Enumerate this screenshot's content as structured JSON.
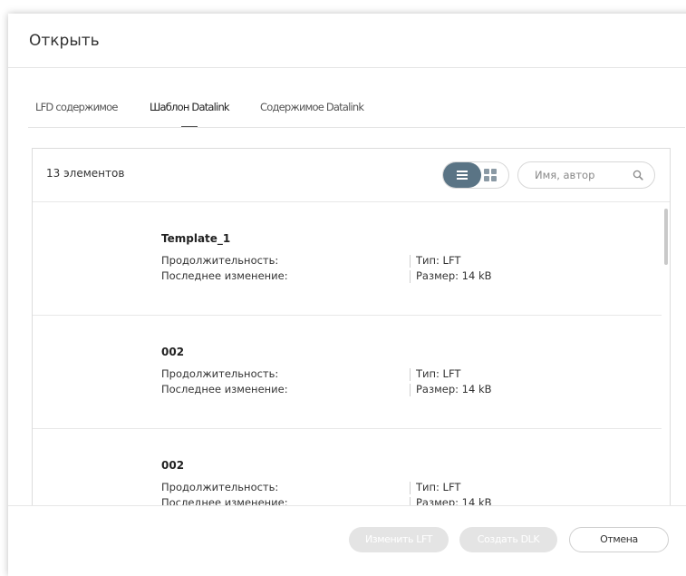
{
  "dialog": {
    "title": "Открыть"
  },
  "tabs": [
    {
      "label": "LFD содержимое",
      "active": false
    },
    {
      "label": "Шаблон Datalink",
      "active": true
    },
    {
      "label": "Содержимое Datalink",
      "active": false
    }
  ],
  "panel": {
    "count": "13 элементов",
    "view": "list",
    "search": {
      "placeholder": "Имя, автор",
      "value": ""
    }
  },
  "items": [
    {
      "name": "Template_1",
      "duration_label": "Продолжительность:",
      "modified_label": "Последнее изменение:",
      "type": "Тип: LFT",
      "size": "Размер: 14 kB"
    },
    {
      "name": "002",
      "duration_label": "Продолжительность:",
      "modified_label": "Последнее изменение:",
      "type": "Тип: LFT",
      "size": "Размер: 14 kB"
    },
    {
      "name": "002",
      "duration_label": "Продолжительность:",
      "modified_label": "Последнее изменение:",
      "type": "Тип: LFT",
      "size": "Размер: 14 kB"
    }
  ],
  "buttons": {
    "edit_lft": "Изменить LFT",
    "create_dlk": "Создать DLK",
    "cancel": "Отмена"
  },
  "colors": {
    "toggle_active": "#5a7485",
    "disabled_button": "#e4e4e4"
  }
}
